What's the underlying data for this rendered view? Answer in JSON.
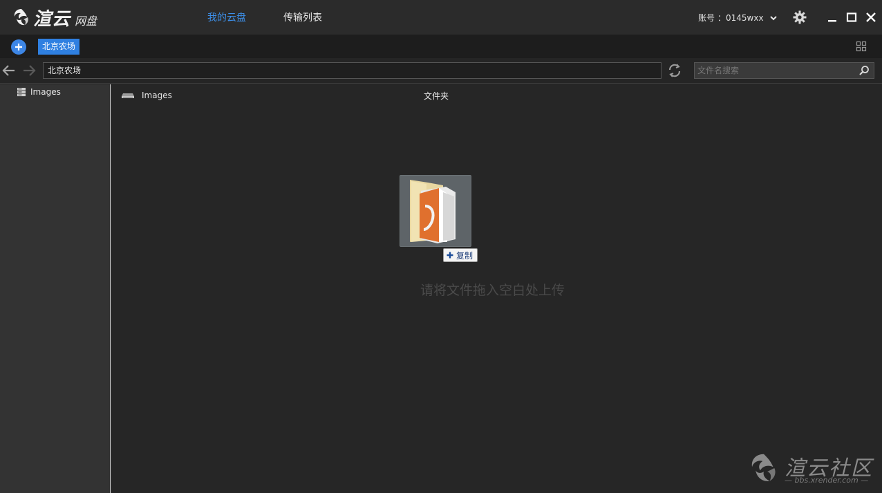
{
  "app": {
    "logo_main": "渲云",
    "logo_sub": "网盘"
  },
  "top_tabs": [
    {
      "label": "我的云盘",
      "active": true
    },
    {
      "label": "传输列表",
      "active": false
    }
  ],
  "account": {
    "label": "账号",
    "value": "：0145wxx"
  },
  "toolbar": {
    "breadcrumb_tag": "北京农场"
  },
  "navbar": {
    "path_value": "北京农场",
    "search_placeholder": "文件名搜索"
  },
  "sidebar": {
    "items": [
      {
        "label": "Images"
      }
    ]
  },
  "files": [
    {
      "name": "Images",
      "type": "文件夹"
    }
  ],
  "drag": {
    "copy_label": "复制"
  },
  "drop_hint": "请将文件拖入空白处上传",
  "watermark": {
    "text": "渲云社区",
    "url": "— bbs.xrender.com —"
  },
  "colors": {
    "accent": "#3d8fe8",
    "tag_bg": "#2f80e1",
    "bg": "#262626"
  }
}
